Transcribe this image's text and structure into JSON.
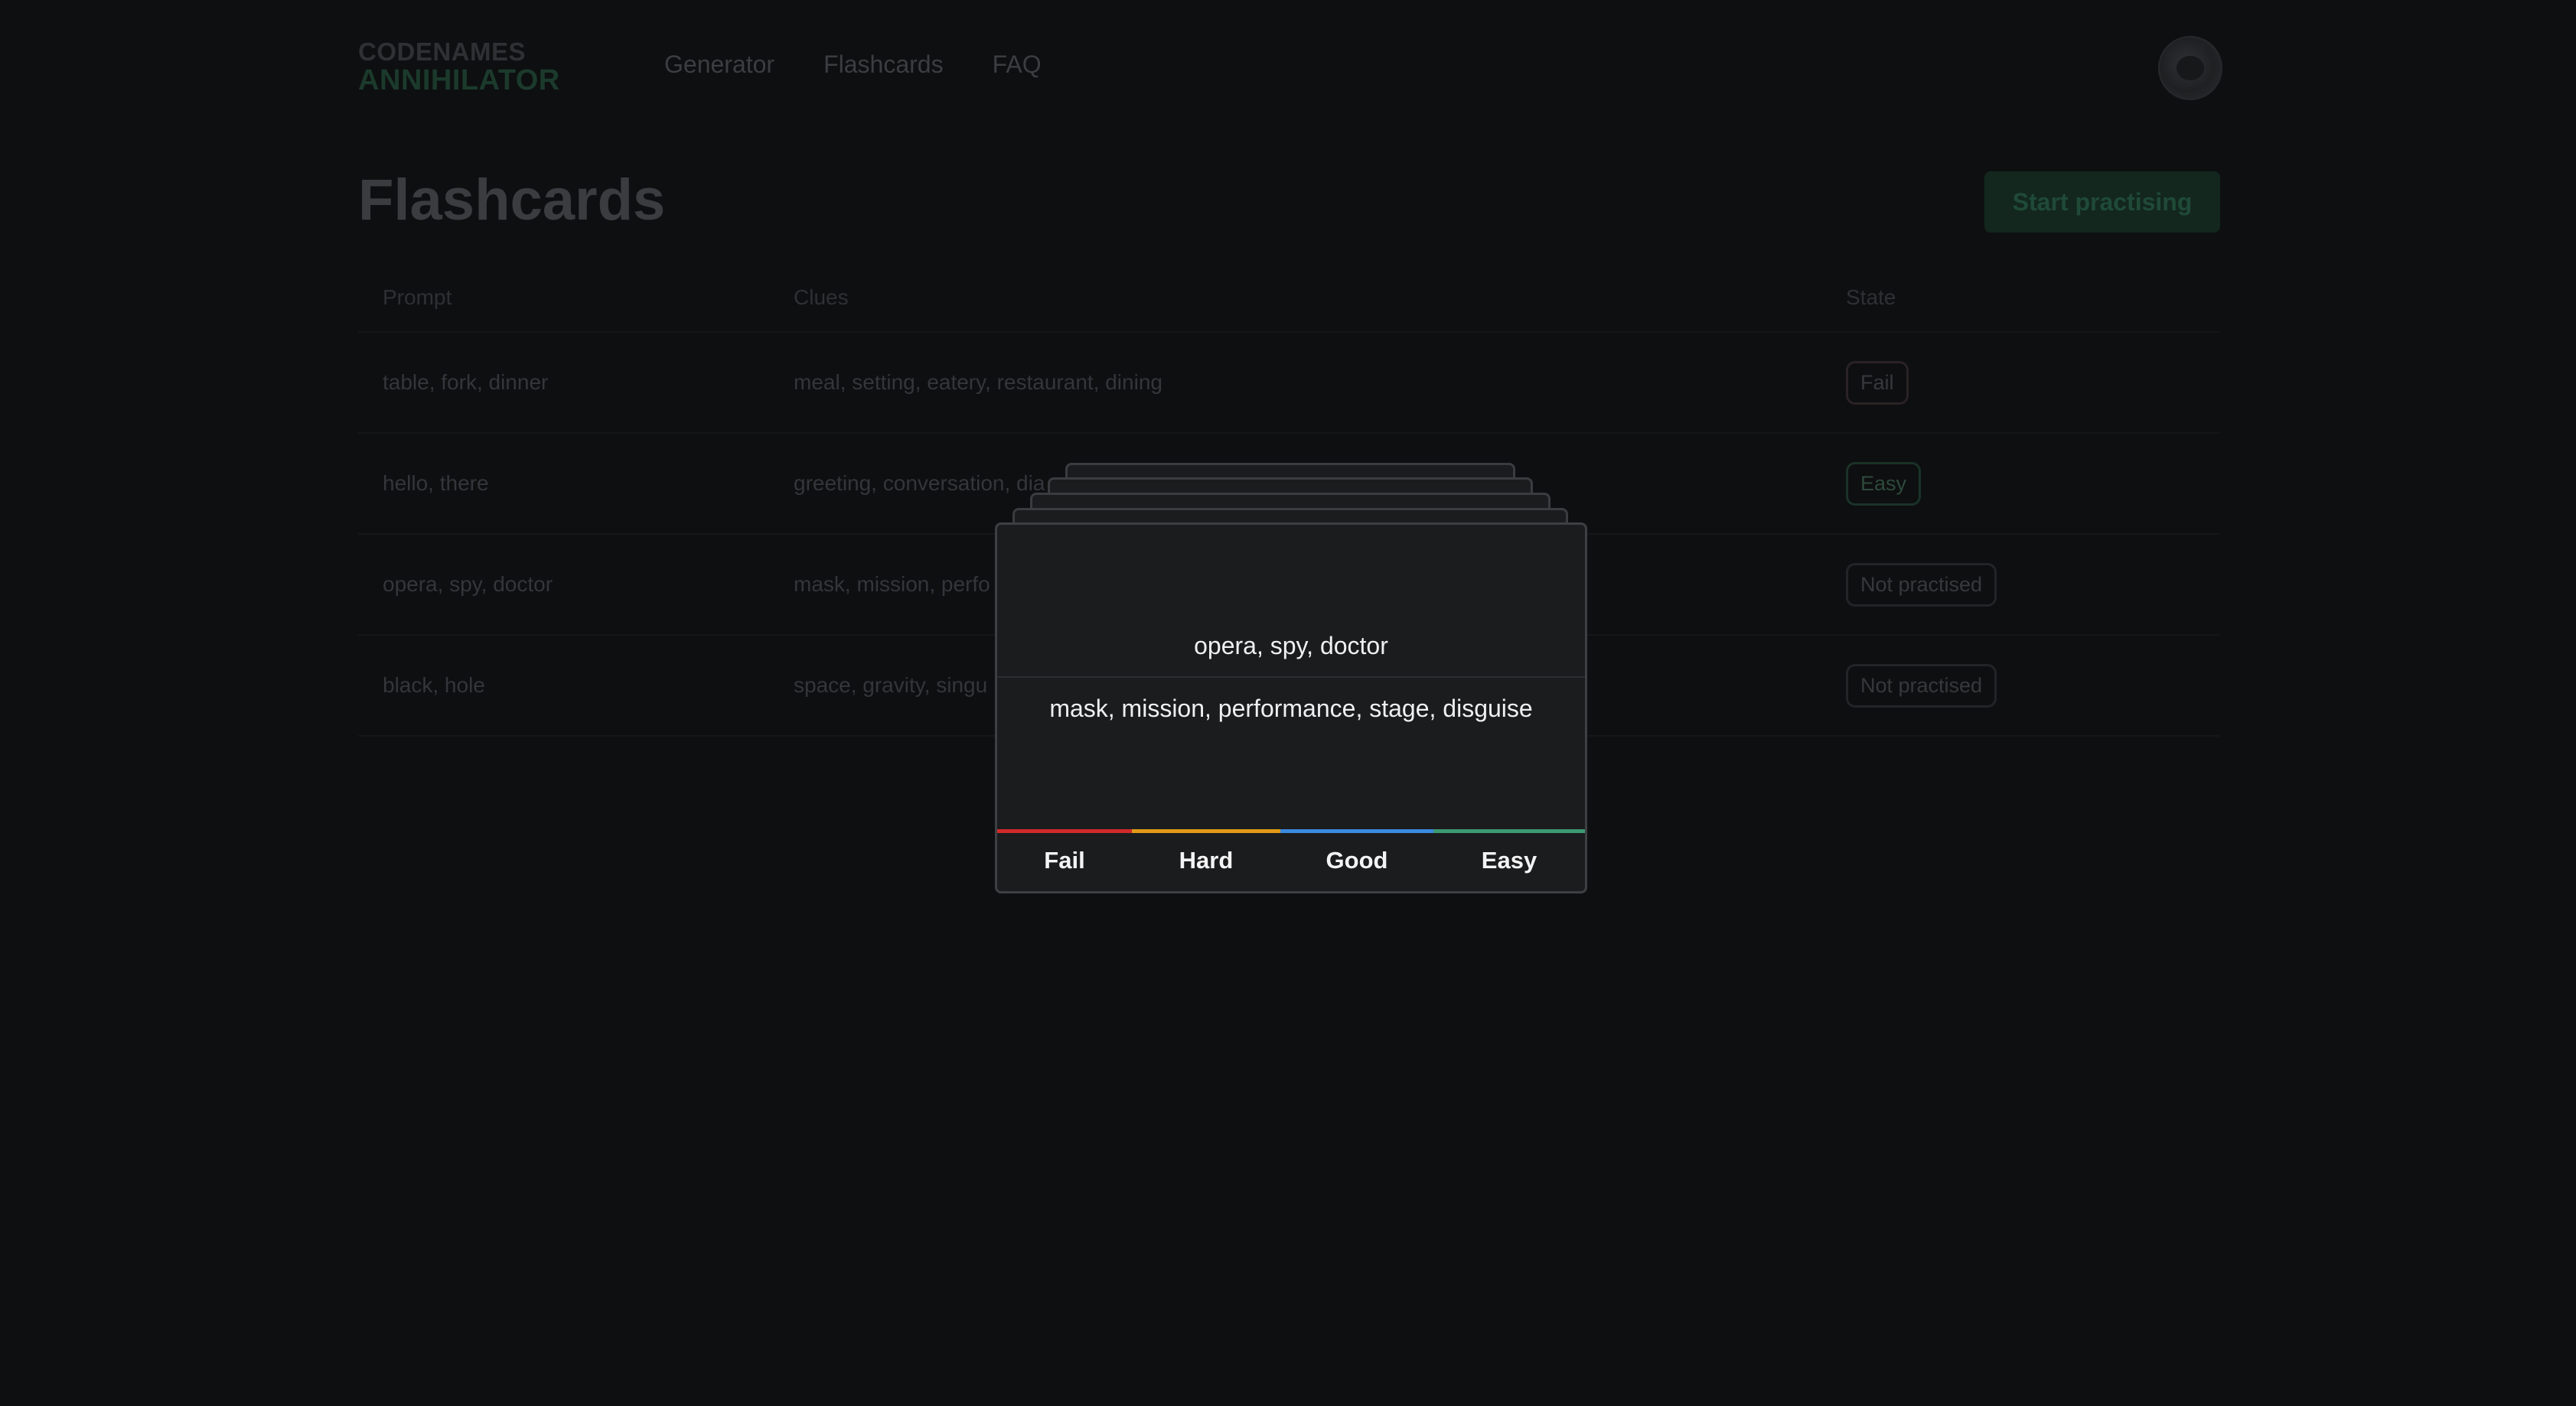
{
  "app": {
    "logo_top": "CODENAMES",
    "logo_bottom": "ANNIHILATOR"
  },
  "nav": {
    "items": [
      {
        "label": "Generator"
      },
      {
        "label": "Flashcards"
      },
      {
        "label": "FAQ"
      }
    ]
  },
  "page": {
    "title": "Flashcards",
    "start_button": "Start practising"
  },
  "table": {
    "headers": {
      "prompt": "Prompt",
      "clues": "Clues",
      "state": "State"
    },
    "rows": [
      {
        "prompt": "table, fork, dinner",
        "clues": "meal, setting, eatery, restaurant, dining",
        "state": "Fail"
      },
      {
        "prompt": "hello, there",
        "clues": "greeting, conversation, dia",
        "state": "Easy"
      },
      {
        "prompt": "opera, spy, doctor",
        "clues": "mask, mission, perfo",
        "state": "Not practised"
      },
      {
        "prompt": "black, hole",
        "clues": "space, gravity, singu",
        "state": "Not practised"
      }
    ]
  },
  "flashcard": {
    "prompt": "opera, spy, doctor",
    "clues": "mask, mission, performance, stage, disguise",
    "ratings": {
      "fail": "Fail",
      "hard": "Hard",
      "good": "Good",
      "easy": "Easy"
    }
  },
  "colors": {
    "fail": "#d12a2a",
    "hard": "#e19a16",
    "good": "#3a8ae0",
    "easy": "#3c9a74",
    "accent": "#1f4a37"
  }
}
